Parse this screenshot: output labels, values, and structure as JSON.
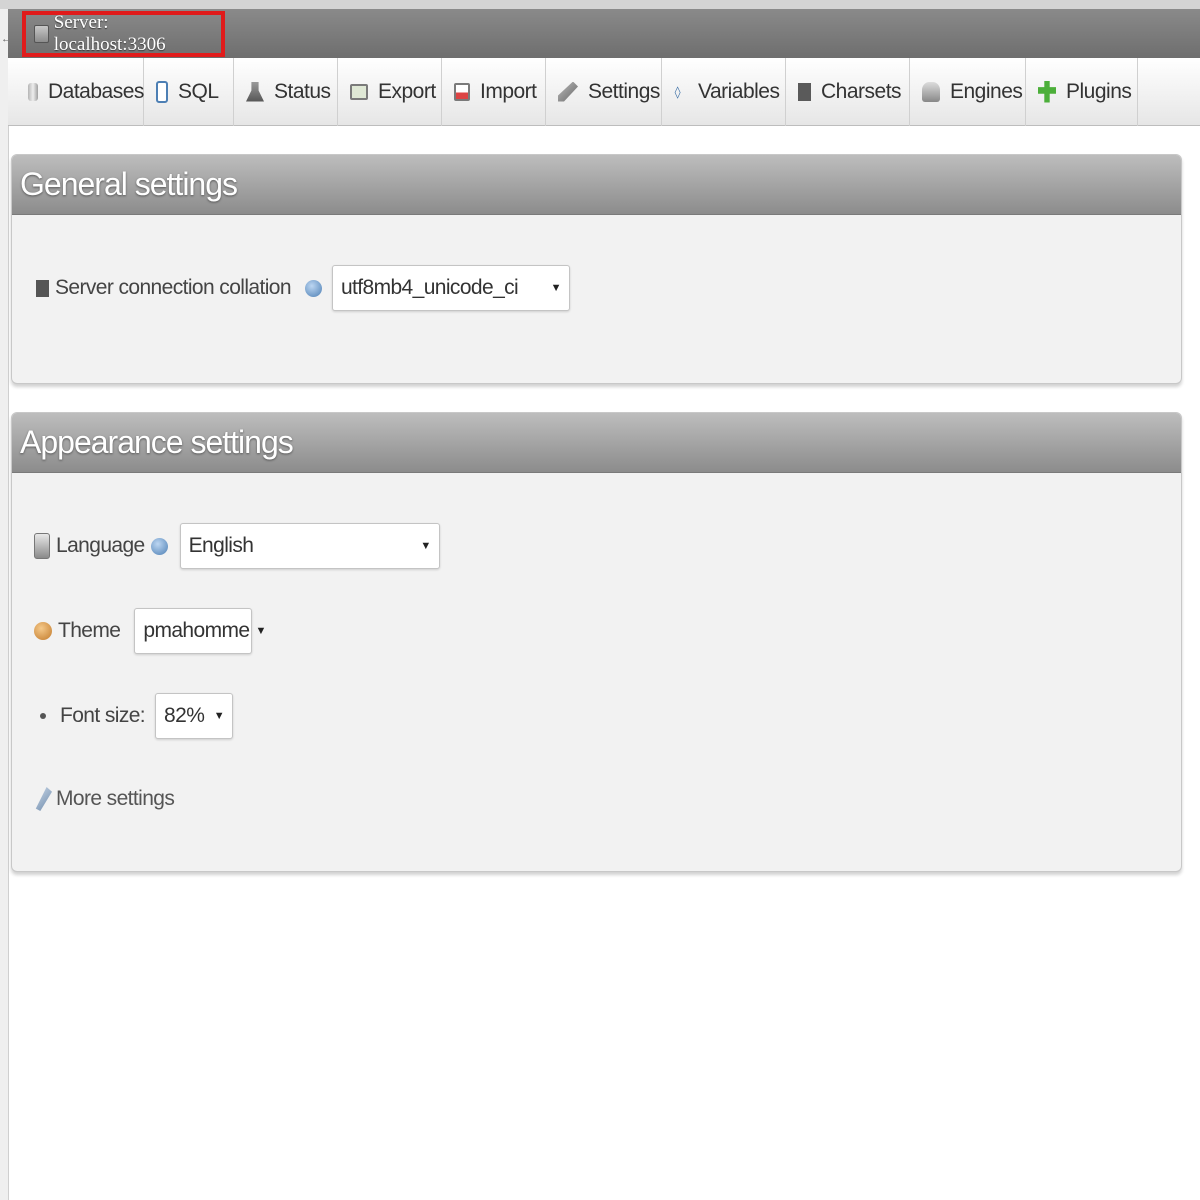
{
  "breadcrumb": {
    "server_label": "Server: localhost:3306"
  },
  "tabs": [
    {
      "label": "Databases",
      "icon": "database-icon"
    },
    {
      "label": "SQL",
      "icon": "sql-icon"
    },
    {
      "label": "Status",
      "icon": "status-icon"
    },
    {
      "label": "Export",
      "icon": "export-icon"
    },
    {
      "label": "Import",
      "icon": "import-icon"
    },
    {
      "label": "Settings",
      "icon": "settings-icon"
    },
    {
      "label": "Variables",
      "icon": "variables-icon"
    },
    {
      "label": "Charsets",
      "icon": "charsets-icon"
    },
    {
      "label": "Engines",
      "icon": "engines-icon"
    },
    {
      "label": "Plugins",
      "icon": "plugins-icon"
    }
  ],
  "general_settings": {
    "title": "General settings",
    "collation_label": "Server connection collation",
    "collation_value": "utf8mb4_unicode_ci"
  },
  "appearance_settings": {
    "title": "Appearance settings",
    "language_label": "Language",
    "language_value": "English",
    "theme_label": "Theme",
    "theme_value": "pmahomme",
    "font_size_label": "Font size:",
    "font_size_value": "82%",
    "more_settings_label": "More settings"
  },
  "colors": {
    "highlight_border": "#e01b1b",
    "panel_header": "#9e9e9e",
    "panel_body": "#f2f2f2"
  }
}
